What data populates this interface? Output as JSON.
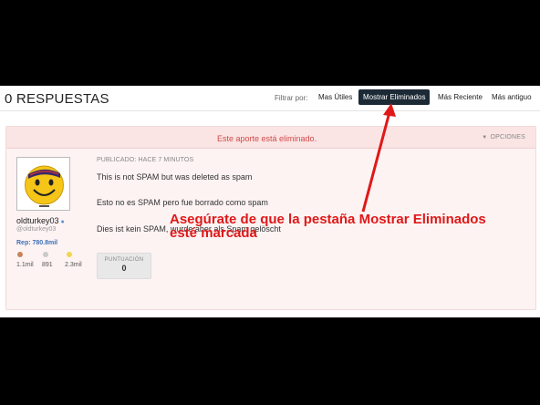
{
  "header": {
    "title": "0 RESPUESTAS",
    "filter_label": "Filtrar por:",
    "filters": [
      {
        "label": "Mas Útiles",
        "active": false
      },
      {
        "label": "Mostrar Eliminados",
        "active": true
      },
      {
        "label": "Más Reciente",
        "active": false
      },
      {
        "label": "Más antiguo",
        "active": false
      }
    ]
  },
  "answer": {
    "deleted_message": "Este aporte está eliminado.",
    "options_label": "OPCIONES",
    "published": "PUBLICADO: HACE 7 MINUTOS",
    "lines": [
      "This is not SPAM but was deleted as spam",
      "Esto no es SPAM pero fue borrado como spam",
      "Dies ist kein SPAM, wurde aber als Spam gelöscht"
    ],
    "score_label": "PUNTUACIÓN",
    "score_value": "0"
  },
  "user": {
    "name": "oldturkey03",
    "handle": "@oldturkey03",
    "reputation": "Rep: 780.8mil",
    "badges": [
      {
        "color": "#c8835a",
        "count": "1.1mil"
      },
      {
        "color": "#c9c9c9",
        "count": "891"
      },
      {
        "color": "#f2d64b",
        "count": "2.3mil"
      }
    ]
  },
  "annotation": {
    "line1": "Asegúrate de que la pestaña Mostrar Eliminados",
    "line2": "esté marcada",
    "color": "#e01818"
  }
}
